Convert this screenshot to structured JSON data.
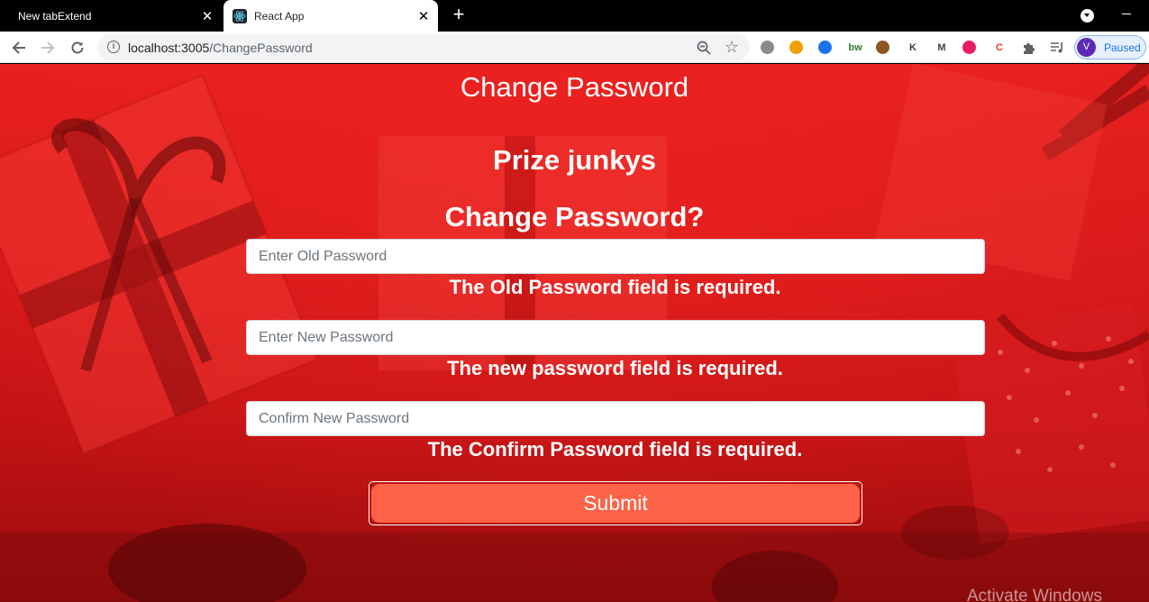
{
  "browser": {
    "tabs": [
      {
        "label": "New tabExtend",
        "active": false
      },
      {
        "label": "React App",
        "active": true
      }
    ],
    "address": {
      "host": "localhost:3005",
      "path": "/ChangePassword"
    },
    "profile": {
      "initial": "V",
      "status": "Paused"
    },
    "extensions": [
      {
        "name": "ext-photo-icon",
        "glyph": "",
        "color": "#8a8a8a"
      },
      {
        "name": "ext-person-check-icon",
        "glyph": "",
        "color": "#f0a000"
      },
      {
        "name": "ext-check-circle-icon",
        "glyph": "",
        "color": "#1a73e8"
      },
      {
        "name": "ext-bw-icon",
        "glyph": "bw",
        "color": "#2e7d32"
      },
      {
        "name": "ext-cookie-icon",
        "glyph": "",
        "color": "#8d5524"
      },
      {
        "name": "ext-k-icon",
        "glyph": "K",
        "color": "#3c3c3c"
      },
      {
        "name": "ext-m-icon",
        "glyph": "M",
        "color": "#444444"
      },
      {
        "name": "ext-color-circle-icon",
        "glyph": "",
        "color": "#e91e63"
      },
      {
        "name": "ext-c-icon",
        "glyph": "C",
        "color": "#e53935"
      }
    ]
  },
  "page": {
    "header_title": "Change Password",
    "brand": "Prize junkys",
    "form_title": "Change Password?",
    "old_password": {
      "placeholder": "Enter Old Password",
      "error": "The Old Password field is required."
    },
    "new_password": {
      "placeholder": "Enter New Password",
      "error": "The new password field is required."
    },
    "confirm_password": {
      "placeholder": "Confirm New Password",
      "error": "The Confirm Password field is required."
    },
    "submit_label": "Submit",
    "accent_color": "#ff6347"
  },
  "system": {
    "watermark": "Activate Windows"
  }
}
